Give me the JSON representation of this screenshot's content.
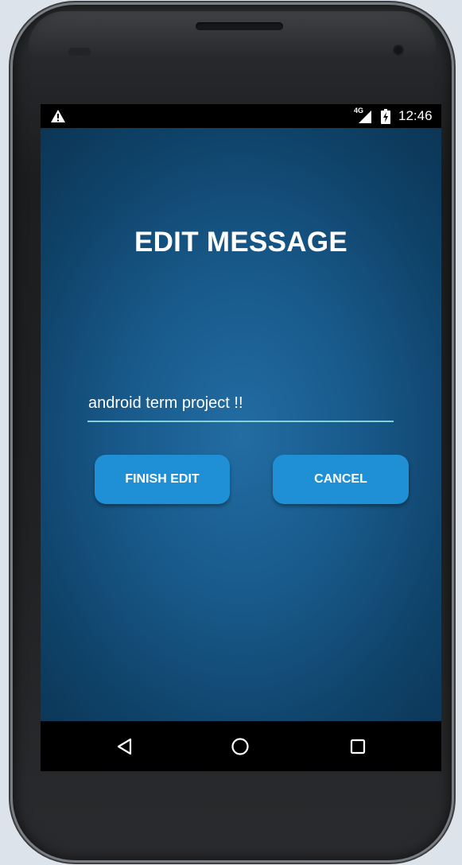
{
  "status_bar": {
    "warning_icon": "warning-triangle-icon",
    "network_label": "4G",
    "battery_icon": "battery-charging-icon",
    "time": "12:46"
  },
  "app": {
    "title": "EDIT MESSAGE",
    "message_value": "android term project !!",
    "finish_label": "FINISH EDIT",
    "cancel_label": "CANCEL",
    "accent_color": "#1f8fd6",
    "underline_color": "#7fd3d9",
    "background_color": "#18598a"
  },
  "nav_bar": {
    "back_icon": "back-triangle-icon",
    "home_icon": "home-circle-icon",
    "recents_icon": "recents-square-icon"
  }
}
